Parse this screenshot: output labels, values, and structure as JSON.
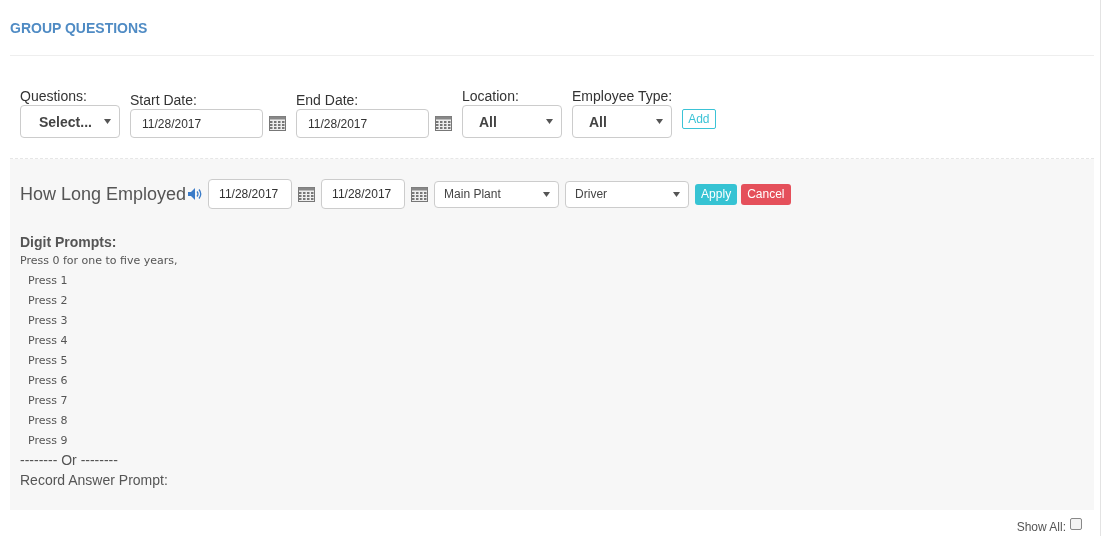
{
  "title": "GROUP QUESTIONS",
  "filters": [
    {
      "kind": "select",
      "label": "Questions:",
      "value": "Select..."
    },
    {
      "kind": "date",
      "label": "Start Date:",
      "value": "11/28/2017"
    },
    {
      "kind": "date",
      "label": "End Date:",
      "value": "11/28/2017"
    },
    {
      "kind": "select",
      "label": "Location:",
      "value": "All"
    },
    {
      "kind": "select",
      "label": "Employee Type:",
      "value": "All"
    }
  ],
  "add_button": "Add",
  "question": {
    "name": "How Long Employed",
    "controls": [
      {
        "kind": "date",
        "value": "11/28/2017"
      },
      {
        "kind": "date",
        "value": "11/28/2017"
      },
      {
        "kind": "select",
        "value": "Main Plant"
      },
      {
        "kind": "select",
        "value": "Driver"
      }
    ],
    "apply_button": "Apply",
    "cancel_button": "Cancel",
    "prompts_heading": "Digit Prompts:",
    "prompts": [
      {
        "kind": "lead",
        "text": "Press 0 for one to five years,"
      },
      {
        "kind": "option",
        "text": "Press 1"
      },
      {
        "kind": "option",
        "text": "Press 2"
      },
      {
        "kind": "option",
        "text": "Press 3"
      },
      {
        "kind": "option",
        "text": "Press 4"
      },
      {
        "kind": "option",
        "text": "Press 5"
      },
      {
        "kind": "option",
        "text": "Press 6"
      },
      {
        "kind": "option",
        "text": "Press 7"
      },
      {
        "kind": "option",
        "text": "Press 8"
      },
      {
        "kind": "option",
        "text": "Press 9"
      }
    ],
    "separator": "-------- Or --------",
    "record_label": "Record Answer Prompt:"
  },
  "show_all": {
    "label": "Show All:",
    "checked": false
  }
}
